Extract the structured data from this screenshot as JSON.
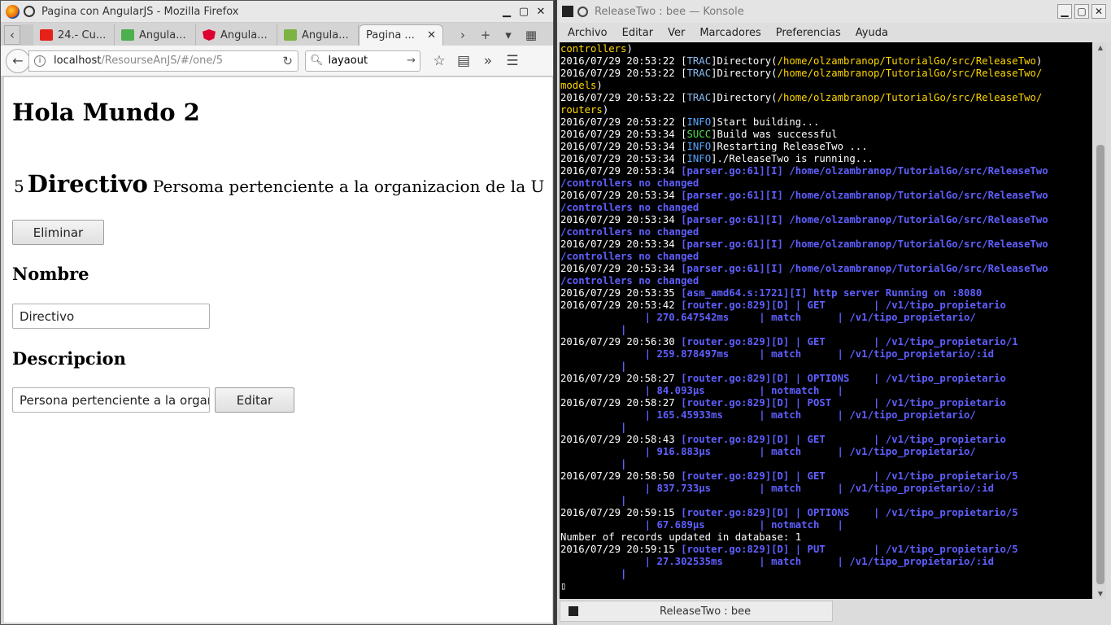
{
  "firefox": {
    "title": "Pagina con AngularJS - Mozilla Firefox",
    "tabs": [
      {
        "label": "24.- Cu...",
        "icon": "youtube-icon",
        "color": "#e62117"
      },
      {
        "label": "Angula...",
        "icon": "angular-icon",
        "color": "#4caf50"
      },
      {
        "label": "Angula...",
        "icon": "angular-icon",
        "color": "#dd0031"
      },
      {
        "label": "Angula...",
        "icon": "vp-icon",
        "color": "#7cb342"
      },
      {
        "label": "Pagina ...",
        "icon": "",
        "color": "",
        "active": true
      }
    ],
    "url_host": "localhost",
    "url_path": "/ResourseAnJS/#/one/5",
    "search_value": "layaout",
    "page": {
      "heading": "Hola Mundo 2",
      "item_id": "5",
      "item_name": "Directivo",
      "item_desc": "Persoma pertenciente a la organizacion de la U",
      "delete_label": "Eliminar",
      "name_label": "Nombre",
      "name_value": "Directivo",
      "desc_label": "Descripcion",
      "desc_value": "Persona pertenciente a la organizacion de la U",
      "edit_label": "Editar"
    }
  },
  "konsole": {
    "title": "ReleaseTwo : bee — Konsole",
    "menu": [
      "Archivo",
      "Editar",
      "Ver",
      "Marcadores",
      "Preferencias",
      "Ayuda"
    ],
    "tab_label": "ReleaseTwo : bee",
    "lines": [
      [
        [
          "c-path",
          "controllers"
        ],
        [
          "c-brk",
          ")"
        ]
      ],
      [
        [
          "",
          "2016/07/29 20:53:22 "
        ],
        [
          "c-brk",
          "["
        ],
        [
          "c-trac",
          "TRAC"
        ],
        [
          "c-brk",
          "]"
        ],
        [
          "",
          "Directory("
        ],
        [
          "c-path",
          "/home/olzambranop/TutorialGo/src/ReleaseTwo"
        ],
        [
          "",
          ")"
        ]
      ],
      [
        [
          "",
          "2016/07/29 20:53:22 "
        ],
        [
          "c-brk",
          "["
        ],
        [
          "c-trac",
          "TRAC"
        ],
        [
          "c-brk",
          "]"
        ],
        [
          "",
          "Directory("
        ],
        [
          "c-path",
          "/home/olzambranop/TutorialGo/src/ReleaseTwo/"
        ]
      ],
      [
        [
          "c-path",
          "models"
        ],
        [
          "",
          ")"
        ]
      ],
      [
        [
          "",
          "2016/07/29 20:53:22 "
        ],
        [
          "c-brk",
          "["
        ],
        [
          "c-trac",
          "TRAC"
        ],
        [
          "c-brk",
          "]"
        ],
        [
          "",
          "Directory("
        ],
        [
          "c-path",
          "/home/olzambranop/TutorialGo/src/ReleaseTwo/"
        ]
      ],
      [
        [
          "c-path",
          "routers"
        ],
        [
          "",
          ")"
        ]
      ],
      [
        [
          "",
          "2016/07/29 20:53:22 "
        ],
        [
          "c-brk",
          "["
        ],
        [
          "c-info",
          "INFO"
        ],
        [
          "c-brk",
          "]"
        ],
        [
          "",
          "Start building..."
        ]
      ],
      [
        [
          "",
          "2016/07/29 20:53:34 "
        ],
        [
          "c-brk",
          "["
        ],
        [
          "c-succ",
          "SUCC"
        ],
        [
          "c-brk",
          "]"
        ],
        [
          "",
          "Build was successful"
        ]
      ],
      [
        [
          "",
          "2016/07/29 20:53:34 "
        ],
        [
          "c-brk",
          "["
        ],
        [
          "c-info",
          "INFO"
        ],
        [
          "c-brk",
          "]"
        ],
        [
          "",
          "Restarting ReleaseTwo ..."
        ]
      ],
      [
        [
          "",
          "2016/07/29 20:53:34 "
        ],
        [
          "c-brk",
          "["
        ],
        [
          "c-info",
          "INFO"
        ],
        [
          "c-brk",
          "]"
        ],
        [
          "",
          "./ReleaseTwo is running..."
        ]
      ],
      [
        [
          "",
          "2016/07/29 20:53:34 "
        ],
        [
          "c-blue",
          "[parser.go:61][I] /home/olzambranop/TutorialGo/src/ReleaseTwo"
        ]
      ],
      [
        [
          "c-blue",
          "/controllers no changed"
        ]
      ],
      [
        [
          "",
          "2016/07/29 20:53:34 "
        ],
        [
          "c-blue",
          "[parser.go:61][I] /home/olzambranop/TutorialGo/src/ReleaseTwo"
        ]
      ],
      [
        [
          "c-blue",
          "/controllers no changed"
        ]
      ],
      [
        [
          "",
          "2016/07/29 20:53:34 "
        ],
        [
          "c-blue",
          "[parser.go:61][I] /home/olzambranop/TutorialGo/src/ReleaseTwo"
        ]
      ],
      [
        [
          "c-blue",
          "/controllers no changed"
        ]
      ],
      [
        [
          "",
          "2016/07/29 20:53:34 "
        ],
        [
          "c-blue",
          "[parser.go:61][I] /home/olzambranop/TutorialGo/src/ReleaseTwo"
        ]
      ],
      [
        [
          "c-blue",
          "/controllers no changed"
        ]
      ],
      [
        [
          "",
          "2016/07/29 20:53:34 "
        ],
        [
          "c-blue",
          "[parser.go:61][I] /home/olzambranop/TutorialGo/src/ReleaseTwo"
        ]
      ],
      [
        [
          "c-blue",
          "/controllers no changed"
        ]
      ],
      [
        [
          "",
          "2016/07/29 20:53:35 "
        ],
        [
          "c-blue",
          "[asm_amd64.s:1721][I] http server Running on :8080"
        ]
      ],
      [
        [
          "",
          "2016/07/29 20:53:42 "
        ],
        [
          "c-blue",
          "[router.go:829][D] | GET        | /v1/tipo_propietario"
        ]
      ],
      [
        [
          "c-blue",
          "              | 270.647542ms     | match      | /v1/tipo_propietario/"
        ]
      ],
      [
        [
          "c-blue",
          "          |"
        ]
      ],
      [
        [
          "",
          "2016/07/29 20:56:30 "
        ],
        [
          "c-blue",
          "[router.go:829][D] | GET        | /v1/tipo_propietario/1"
        ]
      ],
      [
        [
          "c-blue",
          "              | 259.878497ms     | match      | /v1/tipo_propietario/:id"
        ]
      ],
      [
        [
          "c-blue",
          "          |"
        ]
      ],
      [
        [
          "",
          "2016/07/29 20:58:27 "
        ],
        [
          "c-blue",
          "[router.go:829][D] | OPTIONS    | /v1/tipo_propietario"
        ]
      ],
      [
        [
          "c-blue",
          "              | 84.093µs         | notmatch   |"
        ]
      ],
      [
        [
          "",
          "2016/07/29 20:58:27 "
        ],
        [
          "c-blue",
          "[router.go:829][D] | POST       | /v1/tipo_propietario"
        ]
      ],
      [
        [
          "c-blue",
          "              | 165.45933ms      | match      | /v1/tipo_propietario/"
        ]
      ],
      [
        [
          "c-blue",
          "          |"
        ]
      ],
      [
        [
          "",
          "2016/07/29 20:58:43 "
        ],
        [
          "c-blue",
          "[router.go:829][D] | GET        | /v1/tipo_propietario"
        ]
      ],
      [
        [
          "c-blue",
          "              | 916.883µs        | match      | /v1/tipo_propietario/"
        ]
      ],
      [
        [
          "c-blue",
          "          |"
        ]
      ],
      [
        [
          "",
          "2016/07/29 20:58:50 "
        ],
        [
          "c-blue",
          "[router.go:829][D] | GET        | /v1/tipo_propietario/5"
        ]
      ],
      [
        [
          "c-blue",
          "              | 837.733µs        | match      | /v1/tipo_propietario/:id"
        ]
      ],
      [
        [
          "c-blue",
          "          |"
        ]
      ],
      [
        [
          "",
          "2016/07/29 20:59:15 "
        ],
        [
          "c-blue",
          "[router.go:829][D] | OPTIONS    | /v1/tipo_propietario/5"
        ]
      ],
      [
        [
          "c-blue",
          "              | 67.689µs         | notmatch   |"
        ]
      ],
      [
        [
          "",
          "Number of records updated in database: 1"
        ]
      ],
      [
        [
          "",
          "2016/07/29 20:59:15 "
        ],
        [
          "c-blue",
          "[router.go:829][D] | PUT        | /v1/tipo_propietario/5"
        ]
      ],
      [
        [
          "c-blue",
          "              | 27.302535ms      | match      | /v1/tipo_propietario/:id"
        ]
      ],
      [
        [
          "c-blue",
          "          |"
        ]
      ],
      [
        [
          "",
          "▯"
        ]
      ]
    ]
  }
}
